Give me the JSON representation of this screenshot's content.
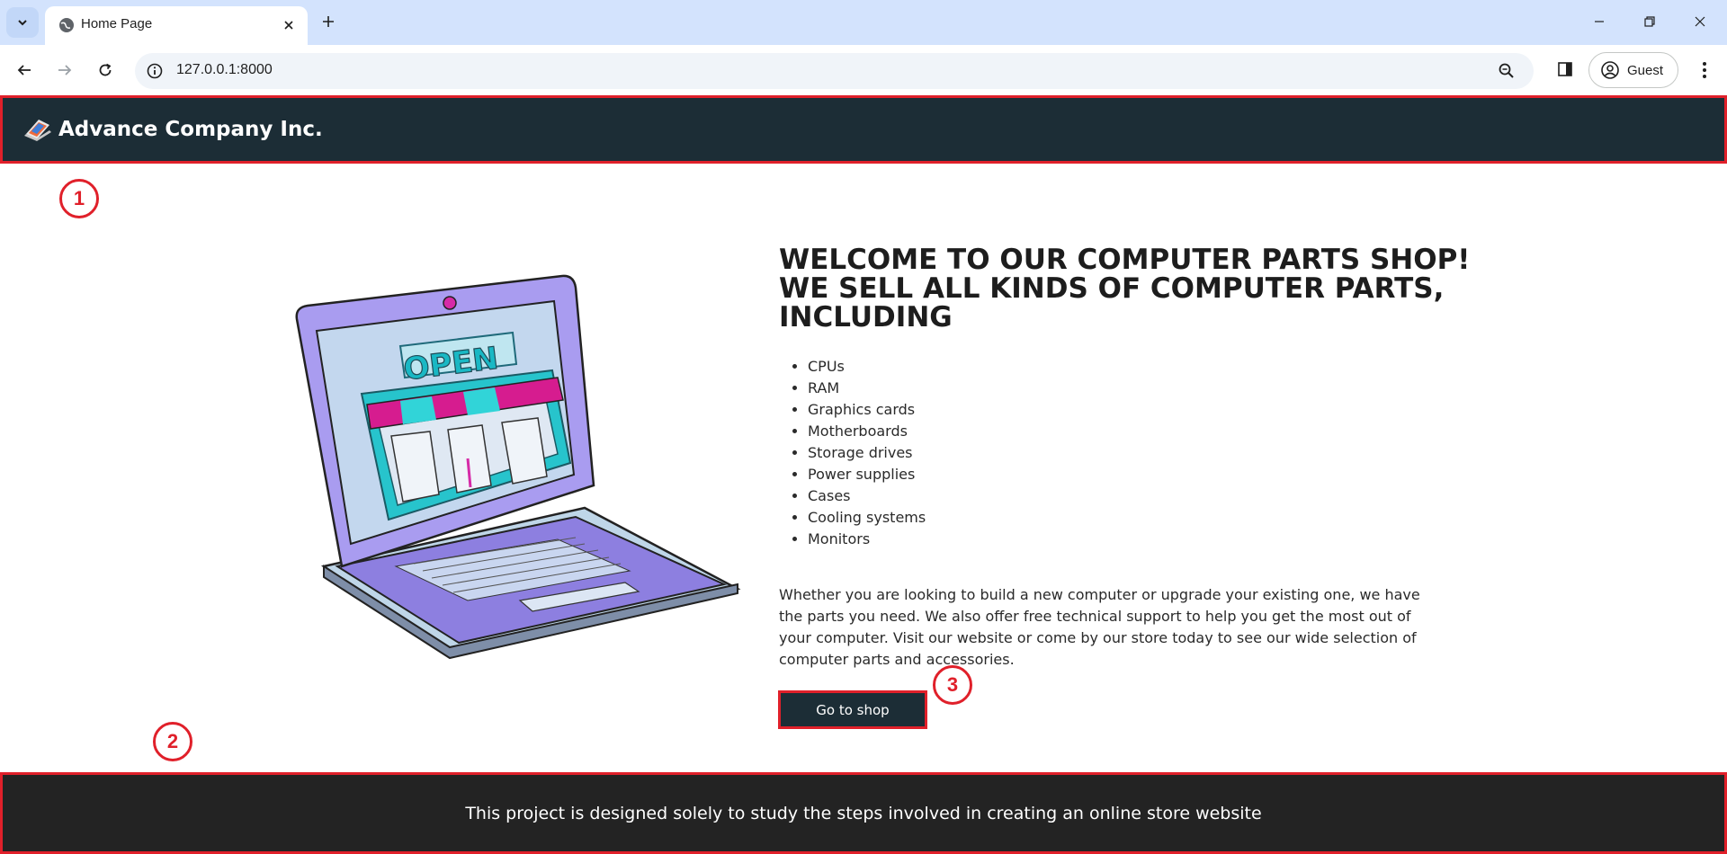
{
  "browser": {
    "tab_title": "Home Page",
    "url": "127.0.0.1:8000",
    "profile_label": "Guest",
    "icons": {
      "tab_search": "chevron-down-icon",
      "favicon": "globe-icon",
      "tab_close": "close-icon",
      "new_tab": "plus-icon",
      "back": "back-arrow-icon",
      "forward": "forward-arrow-icon",
      "reload": "reload-icon",
      "site_info": "info-icon",
      "zoom": "zoom-icon",
      "side_panel": "side-panel-icon",
      "profile": "profile-icon",
      "menu": "kebab-menu-icon",
      "minimize": "minimize-icon",
      "restore": "restore-icon",
      "close_window": "close-window-icon"
    }
  },
  "navbar": {
    "brand": "Advance Company Inc.",
    "background": "#1c2d36"
  },
  "hero": {
    "heading": "WELCOME TO OUR COMPUTER PARTS SHOP! WE SELL ALL KINDS OF COMPUTER PARTS, INCLUDING",
    "parts": [
      "CPUs",
      "RAM",
      "Graphics cards",
      "Motherboards",
      "Storage drives",
      "Power supplies",
      "Cases",
      "Cooling systems",
      "Monitors"
    ],
    "paragraph": "Whether you are looking to build a new computer or upgrade your existing one, we have the parts you need. We also offer free technical support to help you get the most out of your computer. Visit our website or come by our store today to see our wide selection of computer parts and accessories.",
    "image_sign_text": "OPEN",
    "button_label": "Go to shop"
  },
  "footer": {
    "text": "This project is designed solely to study the steps involved in creating an online store website",
    "background": "#232323"
  },
  "annotations": {
    "markers": [
      "1",
      "2",
      "3"
    ],
    "color": "#e0202a"
  }
}
